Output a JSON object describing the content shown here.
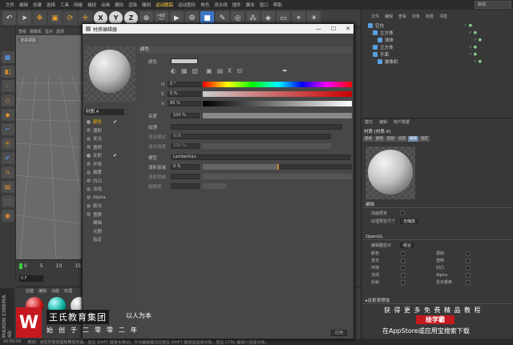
{
  "menubar": {
    "items": [
      "文件",
      "编辑",
      "创建",
      "选择",
      "工具",
      "网格",
      "捕捉",
      "动画",
      "模拟",
      "渲染",
      "雕刻",
      "运动跟踪",
      "运动图形",
      "角色",
      "流水线",
      "插件",
      "脚本",
      "窗口",
      "帮助"
    ],
    "highlight_index": 11,
    "layout_label": "启动"
  },
  "toolbar": {
    "axes": [
      "X",
      "Y",
      "Z"
    ]
  },
  "viewport": {
    "menu": [
      "查看",
      "摄像机",
      "显示",
      "选项"
    ],
    "label": "透视视图"
  },
  "timeline": {
    "ticks": [
      "0",
      "5",
      "10",
      "15"
    ],
    "frame": "0 F"
  },
  "material_manager": {
    "menu": [
      "创建",
      "编辑",
      "功能",
      "纹理"
    ],
    "name": "材质"
  },
  "statusbar": {
    "time": "00:00:00",
    "hint": "移动：点击并拖动鼠标移动元素。按住 SHIFT 键量化移动；节点编辑模式时按住 SHIFT 键增加选择对象；按住 CTRL 键减少选择对象。"
  },
  "editor": {
    "title": "材质编辑器",
    "material_name": "材质.4",
    "channels": [
      {
        "label": "颜色",
        "check": "✔",
        "selected": true,
        "on": true
      },
      {
        "label": "漫射",
        "check": "",
        "on": false
      },
      {
        "label": "发光",
        "check": "",
        "on": false
      },
      {
        "label": "透明",
        "check": "",
        "on": false
      },
      {
        "label": "反射",
        "check": "✔",
        "on": true
      },
      {
        "label": "环境",
        "check": "",
        "on": false
      },
      {
        "label": "烟雾",
        "check": "",
        "on": false
      },
      {
        "label": "凹凸",
        "check": "",
        "on": false
      },
      {
        "label": "法线",
        "check": "",
        "on": false
      },
      {
        "label": "Alpha",
        "check": "",
        "on": false
      },
      {
        "label": "辉光",
        "check": "",
        "on": false
      },
      {
        "label": "置换",
        "check": "",
        "on": false
      }
    ],
    "sub_items": [
      "编辑",
      "光照",
      "指定"
    ],
    "section_color": "颜色",
    "color_label": "颜色",
    "hsv": [
      {
        "k": "H",
        "v": "0 °"
      },
      {
        "k": "S",
        "v": "0 %"
      },
      {
        "k": "V",
        "v": "80 %"
      }
    ],
    "brightness_label": "亮度",
    "brightness_value": "100 %",
    "texture_label": "纹理",
    "blend_mode_label": "混合模式",
    "blend_mode_value": "标准",
    "blend_strength_label": "混合强度",
    "blend_strength_value": "100 %",
    "model_label": "模型",
    "model_value": "Lambertian",
    "diffuse_falloff_label": "漫射衰减",
    "diffuse_falloff_value": "0 %",
    "diffuse_level_label": "漫射层级",
    "roughness_label": "粗糙度",
    "apply_label": "应用"
  },
  "object_manager": {
    "menu": [
      "文件",
      "编辑",
      "查看",
      "对象",
      "标签",
      "书签"
    ],
    "objects": [
      {
        "name": "空白"
      },
      {
        "name": "立方体"
      },
      {
        "name": "球体"
      },
      {
        "name": "立方体"
      },
      {
        "name": "平面"
      },
      {
        "name": "摄像机"
      }
    ]
  },
  "attributes": {
    "menu": [
      "模式",
      "编辑",
      "用户数据"
    ],
    "title": "材质 [材质.4]",
    "tabs": [
      "基本",
      "颜色",
      "反射",
      "光照",
      "编辑",
      "指定"
    ],
    "active_tab": 4,
    "section_edit": "编辑",
    "anim_preview_label": "动画预览",
    "anim_preview_value": "",
    "tex_preview_label": "纹理预览尺寸",
    "tex_preview_value": "无缩放",
    "opengl": "OpenGL",
    "editor_display_label": "编辑器显示",
    "editor_display_value": "组合",
    "grid": [
      [
        "颜色",
        "漫射"
      ],
      [
        "发光",
        "透明"
      ],
      [
        "环境",
        "凹凸"
      ],
      [
        "法线",
        "Alpha"
      ],
      [
        "反射",
        "显示置换"
      ]
    ],
    "reflectance": "▸反射率预设"
  },
  "overlay": {
    "brand": "王氏教育集团",
    "slogan": "以人为本",
    "founded": "始创于二零零二年",
    "promo1": "获得更多免费精品教程",
    "promo2": "绘学霸",
    "promo3": "在AppStore或应用宝搜索下载",
    "side": "MAXON CINEMA 4D"
  }
}
